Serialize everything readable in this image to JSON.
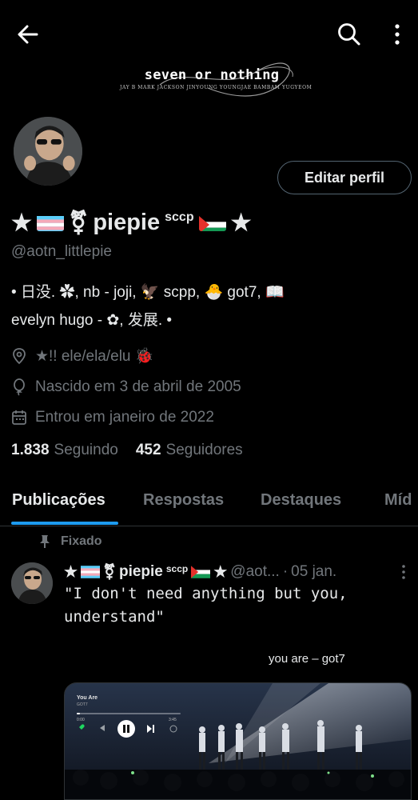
{
  "profile": {
    "banner": {
      "title": "seven or nothing",
      "subtitle": "JAY B MARK JACKSON JINYOUNG YOUNGJAE BAMBAM YUGYEOM"
    },
    "edit_button": "Editar perfil",
    "name_prefix": "★",
    "name_gender_symbol": "⚧",
    "name": "piepie",
    "name_superscript": "sccp",
    "name_suffix": "★",
    "handle": "@aotn_littlepie",
    "bio_line1": "• 日没.  ✿,  nb  -  joji,  🦅  scpp,  🐣 got7,  📖",
    "bio_line2": "evelyn hugo  -  ✿,  发展. •",
    "pronouns": "★!! ele/ela/elu 🐞",
    "birthday": "Nascido em 3 de abril de 2005",
    "joined": "Entrou em janeiro de 2022",
    "following_count": "1.838",
    "following_label": "Seguindo",
    "followers_count": "452",
    "followers_label": "Seguidores"
  },
  "tabs": [
    "Publicações",
    "Respostas",
    "Destaques",
    "Míd"
  ],
  "post": {
    "pinned_label": "Fixado",
    "author_prefix": "★",
    "author_gender_symbol": "⚧",
    "author_name": "piepie",
    "author_superscript": "sccp",
    "author_suffix": "★",
    "handle": "@aot...",
    "separator": "·",
    "date": "05 jan.",
    "text_line1": "\"I don't need anything but you,",
    "text_line2": "understand\"",
    "caption": "you are – got7",
    "media_song": "You Are",
    "media_artist": "GOT7",
    "media_time_start": "0:00",
    "media_time_end": "3:45"
  },
  "colors": {
    "background": "#000000",
    "text": "#e7e9ea",
    "muted": "#71767b",
    "accent": "#1d9bf0",
    "border": "#2f3336"
  },
  "icons": [
    "back-arrow-icon",
    "search-icon",
    "more-vertical-icon",
    "location-icon",
    "balloon-icon",
    "calendar-icon",
    "pin-icon"
  ]
}
